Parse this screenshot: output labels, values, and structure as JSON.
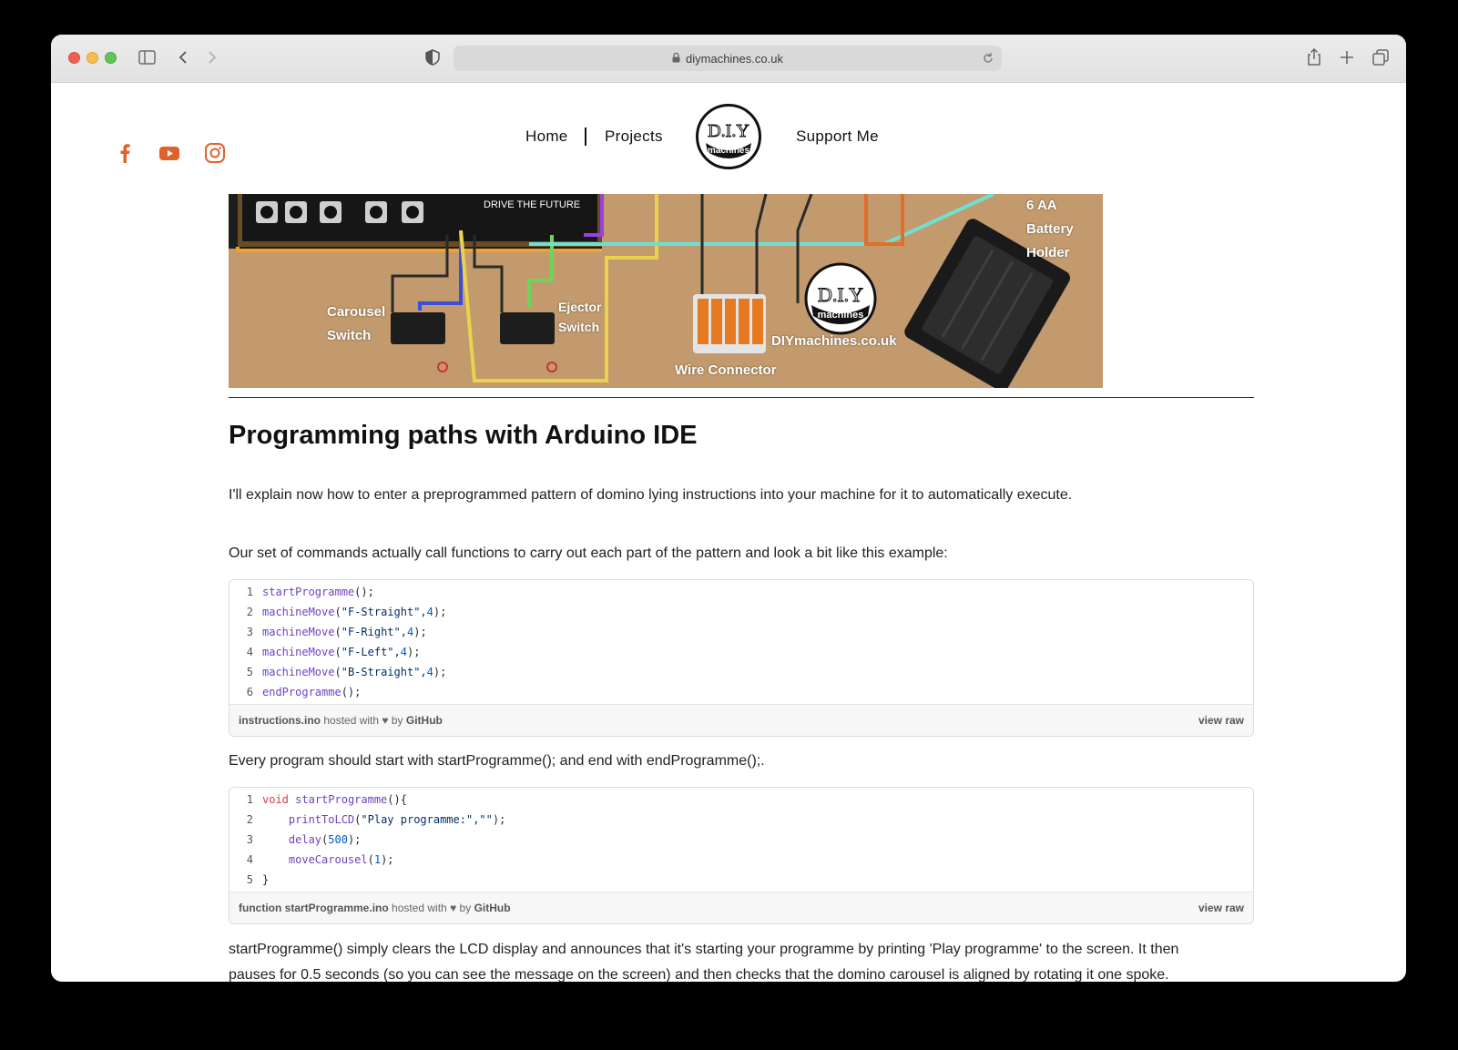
{
  "browser": {
    "url": "diymachines.co.uk"
  },
  "site": {
    "nav": {
      "home": "Home",
      "projects": "Projects",
      "support": "Support Me"
    },
    "logo": {
      "line1": "D.I.Y",
      "line2": "machines"
    },
    "social_colors": "#e0622b"
  },
  "hero": {
    "labels": {
      "carousel_switch": [
        "Carousel",
        "Switch"
      ],
      "ejector_switch": [
        "Ejector",
        "Switch"
      ],
      "battery": [
        "6 AA",
        "Battery",
        "Holder"
      ],
      "wire_connector": "Wire Connector",
      "site": "DIYmachines.co.uk",
      "board_text": "DRIVE THE FUTURE"
    }
  },
  "article": {
    "title": "Programming paths with Arduino IDE",
    "para1": "I'll explain now how to enter a preprogrammed pattern of domino lying instructions into your machine for it to automatically execute.",
    "para2": "Our set of commands actually call functions to carry out each part of the pattern and look a bit like this example:",
    "para3": "Every program should start with startProgramme(); and end with endProgramme();.",
    "para4": "startProgramme() simply clears the LCD display and announces that it's starting your programme by printing 'Play programme' to the screen. It then",
    "para5": "pauses for 0.5 seconds (so you can see the message on the screen) and then checks that the domino carousel is aligned by rotating it one spoke."
  },
  "gist1": {
    "filename": "instructions.ino",
    "hosted": "hosted with",
    "heart": "♥",
    "by": "by",
    "github": "GitHub",
    "view_raw": "view raw",
    "lines": [
      {
        "n": "1",
        "fn": "startProgramme",
        "args": "();"
      },
      {
        "n": "2",
        "fn": "machineMove",
        "str": "\"F-Straight\"",
        "num": "4"
      },
      {
        "n": "3",
        "fn": "machineMove",
        "str": "\"F-Right\"",
        "num": "4"
      },
      {
        "n": "4",
        "fn": "machineMove",
        "str": "\"F-Left\"",
        "num": "4"
      },
      {
        "n": "5",
        "fn": "machineMove",
        "str": "\"B-Straight\"",
        "num": "4"
      },
      {
        "n": "6",
        "fn": "endProgramme",
        "args": "();"
      }
    ]
  },
  "gist2": {
    "filename": "function startProgramme.ino",
    "hosted": "hosted with",
    "heart": "♥",
    "by": "by",
    "github": "GitHub",
    "view_raw": "view raw",
    "l1": {
      "n": "1",
      "kw": "void",
      "fn": "startProgramme",
      "rest": "(){"
    },
    "l2": {
      "n": "2",
      "fn": "printToLCD",
      "str": "\"Play programme:\",\"\"",
      "rest": ");"
    },
    "l3": {
      "n": "3",
      "fn": "delay",
      "num": "500"
    },
    "l4": {
      "n": "4",
      "fn": "moveCarousel",
      "num": "1"
    },
    "l5": {
      "n": "5",
      "rest": "}"
    }
  }
}
